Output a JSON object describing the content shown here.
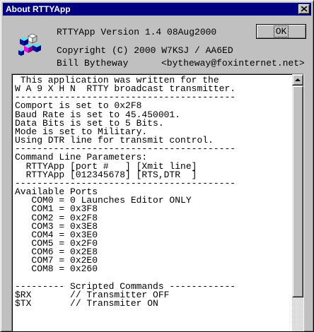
{
  "window": {
    "title": "About RTTYApp",
    "close_icon": "close-icon"
  },
  "info": {
    "line1": "RTTYApp Version 1.4 08Aug2000",
    "line2": "Copyright (C) 2000 W7KSJ / AA6ED",
    "line3_name": "Bill Bytheway",
    "line3_email": "<bytheway@foxinternet.net>"
  },
  "buttons": {
    "ok_label": "OK"
  },
  "textbox": {
    "lines": [
      " This application was written for the",
      "W A 9 X H N  RTTY broadcast transmitter.",
      "----------------------------------------",
      "Comport is set to 0x2F8",
      "Baud Rate is set to 45.450001.",
      "Data Bits is set to 5 Bits.",
      "Mode is set to Military.",
      "Using DTR line for transmit control.",
      "----------------------------------------",
      "Command Line Parameters:",
      "  RTTYApp [port #   ] [Xmit line]",
      "  RTTYApp [012345678] [RTS,DTR  ]",
      "----------------------------------------",
      "Available Ports",
      "   COM0 = 0 Launches Editor ONLY",
      "   COM1 = 0x3F8",
      "   COM2 = 0x2F8",
      "   COM3 = 0x3E8",
      "   COM4 = 0x3E0",
      "   COM5 = 0x2F0",
      "   COM6 = 0x2E8",
      "   COM7 = 0x2E0",
      "   COM8 = 0x260",
      "",
      "--------- Scripted Commands ------------",
      "$RX       // Transmitter OFF",
      "$TX       // Transmiter ON"
    ]
  },
  "colors": {
    "titlebar": "#000080",
    "face": "#c0c0c0"
  }
}
